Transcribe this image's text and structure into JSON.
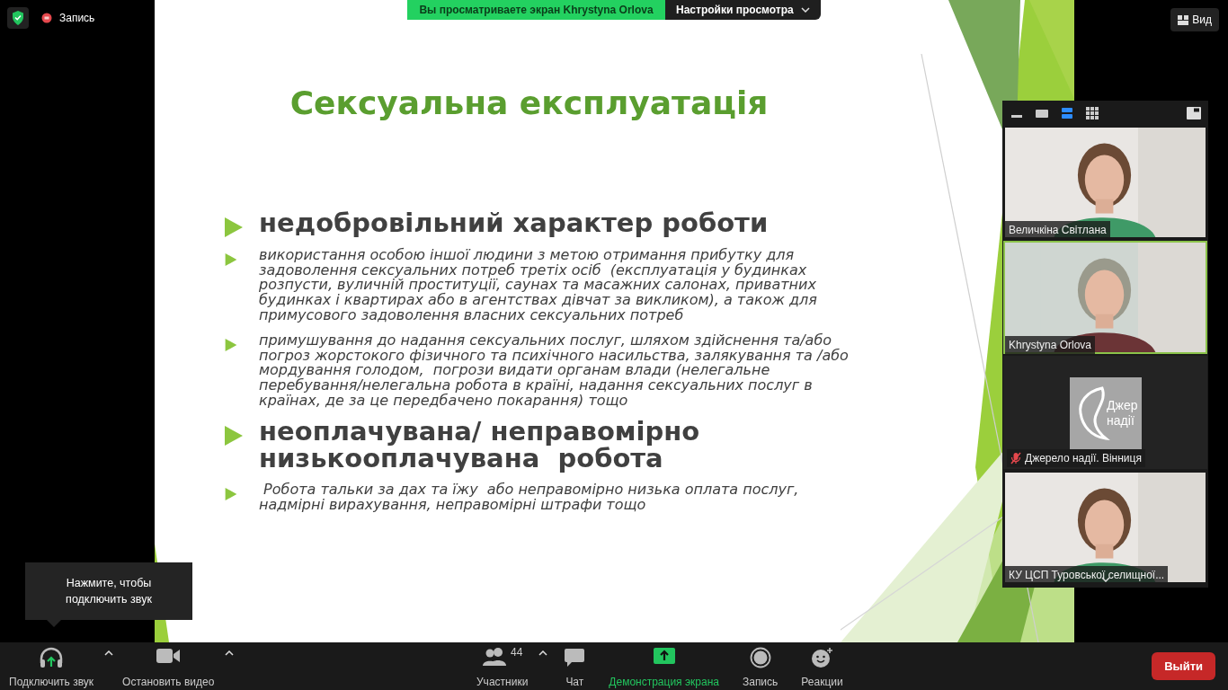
{
  "top_bar": {
    "recording": "Запись",
    "view_button": "Вид"
  },
  "share_banner": {
    "status": "Вы просматриваете экран Khrystyna Orlova",
    "options": "Настройки просмотра"
  },
  "slide": {
    "title": "Сексуальна експлуатація",
    "bullets": [
      {
        "kind": "major",
        "text": "недобровільний характер роботи"
      },
      {
        "kind": "minor",
        "text": "використання особою іншої людини з метою отримання прибутку для задоволення сексуальних потреб третіх осіб  (експлуатація у будинках розпусти, вуличній проституції, саунах та масажних салонах, приватних будинках і квартирах або в агентствах дівчат за викликом), а також для примусового задоволення власних сексуальних потреб"
      },
      {
        "kind": "minor",
        "text": "примушування до надання сексуальних послуг, шляхом здійснення та/або погроз жорстокого фізичного та психічного насильства, залякування та /або мордування голодом,  погрози видати органам влади (нелегальне перебування/нелегальна робота в країні, надання сексуальних послуг в країнах, де за це передбачено покарання) тощо"
      },
      {
        "kind": "major",
        "text": "неоплачувана/ неправомірно низькооплачувана  робота"
      },
      {
        "kind": "minor",
        "text": " Робота тальки за дах та їжу  або неправомірно низька оплата послуг, надмірні вирахування, неправомірні штрафи тощо"
      }
    ]
  },
  "gallery": {
    "view_modes": [
      {
        "kind": "minimize",
        "selected": false
      },
      {
        "kind": "speaker",
        "selected": false
      },
      {
        "kind": "strip",
        "selected": true
      },
      {
        "kind": "grid",
        "selected": false
      }
    ],
    "participants": [
      {
        "kind": "video",
        "name": "Величкіна Світлана",
        "muted": false,
        "active_speaker": false
      },
      {
        "kind": "video",
        "name": "Khrystyna Orlova",
        "muted": false,
        "active_speaker": true
      },
      {
        "kind": "logo",
        "name": "Джерело надії. Вінниця",
        "muted": true,
        "active_speaker": false,
        "logo_text": [
          "Джер",
          "надії"
        ]
      },
      {
        "kind": "video",
        "name": "КУ ЦСП Туровської селищної...",
        "muted": false,
        "active_speaker": false
      }
    ]
  },
  "tooltip": "Нажмите, чтобы подключить звук",
  "toolbar": {
    "left": [
      {
        "kind": "audio",
        "label": "Подключить звук",
        "has_menu": true
      },
      {
        "kind": "video",
        "label": "Остановить видео",
        "has_menu": true
      }
    ],
    "center": [
      {
        "kind": "participants",
        "label": "Участники",
        "count": "44",
        "has_menu": true,
        "active": false
      },
      {
        "kind": "chat",
        "label": "Чат",
        "has_menu": false,
        "active": false
      },
      {
        "kind": "share",
        "label": "Демонстрация экрана",
        "has_menu": false,
        "active": true
      },
      {
        "kind": "record",
        "label": "Запись",
        "has_menu": false,
        "active": false
      },
      {
        "kind": "reactions",
        "label": "Реакции",
        "has_menu": false,
        "active": false
      }
    ],
    "leave": "Выйти"
  }
}
